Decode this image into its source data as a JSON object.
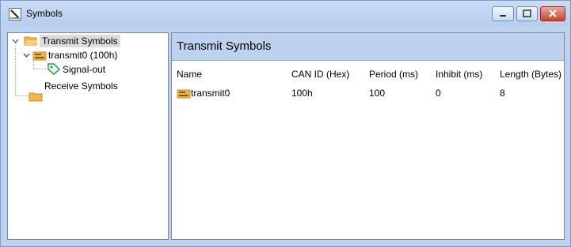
{
  "window": {
    "title": "Symbols"
  },
  "tree": {
    "transmit_label": "Transmit Symbols",
    "message_label": "transmit0 (100h)",
    "signal_label": "Signal-out",
    "receive_label": "Receive Symbols"
  },
  "panel": {
    "title": "Transmit Symbols",
    "columns": [
      "Name",
      "CAN ID (Hex)",
      "Period (ms)",
      "Inhibit (ms)",
      "Length (Bytes)"
    ],
    "rows": [
      {
        "name": "transmit0",
        "can_id": "100h",
        "period": "100",
        "inhibit": "0",
        "length": "8"
      }
    ]
  },
  "colors": {
    "frame": "#bcd2ee",
    "selection": "#dcdcdc",
    "folder": "#f0b64a",
    "close": "#c7432f"
  }
}
